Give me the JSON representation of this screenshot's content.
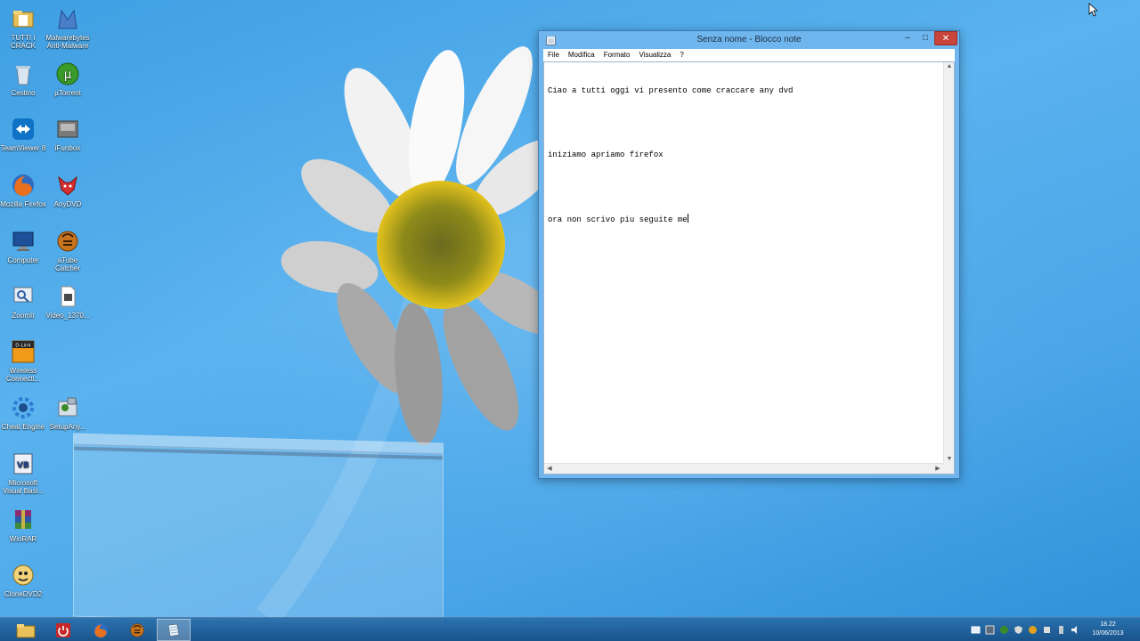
{
  "desktop": {
    "icons": [
      {
        "label": "TUTTI I CRACK",
        "icon": "folder-icon"
      },
      {
        "label": "Malwarebytes Anti-Malware",
        "icon": "malwarebytes-icon"
      },
      {
        "label": "Cestino",
        "icon": "recycle-bin-icon"
      },
      {
        "label": "µTorrent",
        "icon": "utorrent-icon"
      },
      {
        "label": "TeamViewer 8",
        "icon": "teamviewer-icon"
      },
      {
        "label": "iFunbox",
        "icon": "ifunbox-icon"
      },
      {
        "label": "Mozilla Firefox",
        "icon": "firefox-icon"
      },
      {
        "label": "AnyDVD",
        "icon": "anydvd-icon"
      },
      {
        "label": "Computer",
        "icon": "computer-icon"
      },
      {
        "label": "aTube Catcher",
        "icon": "atube-catcher-icon"
      },
      {
        "label": "ZoomIt",
        "icon": "zoomit-icon"
      },
      {
        "label": "Video_1370...",
        "icon": "video-file-icon"
      },
      {
        "label": "Wireless Connecti...",
        "icon": "dlink-icon"
      },
      {
        "label": "Cheat Engine",
        "icon": "cheat-engine-icon"
      },
      {
        "label": "SetupAny...",
        "icon": "setup-icon"
      },
      {
        "label": "Microsoft Visual Basi...",
        "icon": "visual-basic-icon"
      },
      {
        "label": "WinRAR",
        "icon": "winrar-icon"
      },
      {
        "label": "CloneDVD2",
        "icon": "clonedvd-icon"
      }
    ]
  },
  "notepad": {
    "title": "Senza nome - Blocco note",
    "min_label": "–",
    "max_label": "□",
    "close_label": "✕",
    "menu": [
      "File",
      "Modifica",
      "Formato",
      "Visualizza",
      "?"
    ],
    "lines": [
      "Ciao a tutti oggi vi presento come craccare any dvd",
      "",
      "iniziamo apriamo firefox",
      "",
      "ora non scrivo piu seguite me"
    ]
  },
  "taskbar": {
    "pinned": [
      {
        "icon": "file-explorer-icon"
      },
      {
        "icon": "power-icon"
      },
      {
        "icon": "firefox-icon"
      },
      {
        "icon": "atube-catcher-icon"
      },
      {
        "icon": "notepad-icon",
        "active": true
      }
    ],
    "clock_time": "18.22",
    "clock_date": "10/06/2013"
  },
  "colors": {
    "accent": "#3f9fe3",
    "window_frame": "#6fb6ee",
    "close_button": "#c9443a"
  }
}
